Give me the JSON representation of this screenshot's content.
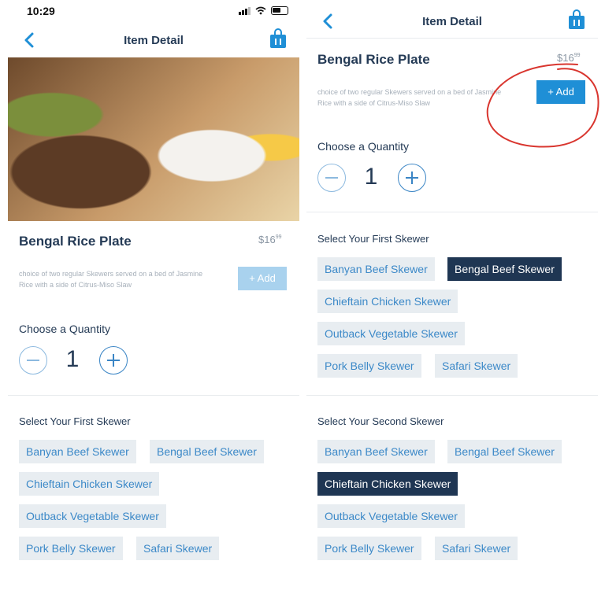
{
  "left": {
    "status": {
      "time": "10:29"
    },
    "nav": {
      "title": "Item Detail"
    },
    "item": {
      "name": "Bengal Rice Plate",
      "price_main": "$16",
      "price_cents": "99",
      "description": "choice of two regular Skewers served on a bed of Jasmine Rice with a side of Citrus-Miso Slaw",
      "add_label": "+ Add"
    },
    "quantity": {
      "label": "Choose a Quantity",
      "value": "1"
    },
    "first_skewer": {
      "label": "Select Your First Skewer",
      "options": [
        "Banyan Beef Skewer",
        "Bengal Beef Skewer",
        "Chieftain Chicken Skewer",
        "Outback Vegetable Skewer",
        "Pork Belly Skewer",
        "Safari Skewer"
      ],
      "selected": null
    }
  },
  "right": {
    "nav": {
      "title": "Item Detail"
    },
    "item": {
      "name": "Bengal Rice Plate",
      "price_main": "$16",
      "price_cents": "99",
      "description": "choice of two regular Skewers served on a bed of Jasmine Rice with a side of Citrus-Miso Slaw",
      "add_label": "+ Add"
    },
    "quantity": {
      "label": "Choose a Quantity",
      "value": "1"
    },
    "first_skewer": {
      "label": "Select Your First Skewer",
      "options": [
        "Banyan Beef Skewer",
        "Bengal Beef Skewer",
        "Chieftain Chicken Skewer",
        "Outback Vegetable Skewer",
        "Pork Belly Skewer",
        "Safari Skewer"
      ],
      "selected": "Bengal Beef Skewer"
    },
    "second_skewer": {
      "label": "Select Your Second Skewer",
      "options": [
        "Banyan Beef Skewer",
        "Bengal Beef Skewer",
        "Chieftain Chicken Skewer",
        "Outback Vegetable Skewer",
        "Pork Belly Skewer",
        "Safari Skewer"
      ],
      "selected": "Chieftain Chicken Skewer"
    }
  },
  "colors": {
    "accent": "#1f8fd6",
    "selected_chip": "#1f3653",
    "chip_bg": "#e8edf1",
    "annotation": "#d9362f"
  },
  "icons": {
    "back": "chevron-left-icon",
    "bag": "shopping-bag-icon",
    "minus": "minus-circle-icon",
    "plus": "plus-circle-icon"
  }
}
